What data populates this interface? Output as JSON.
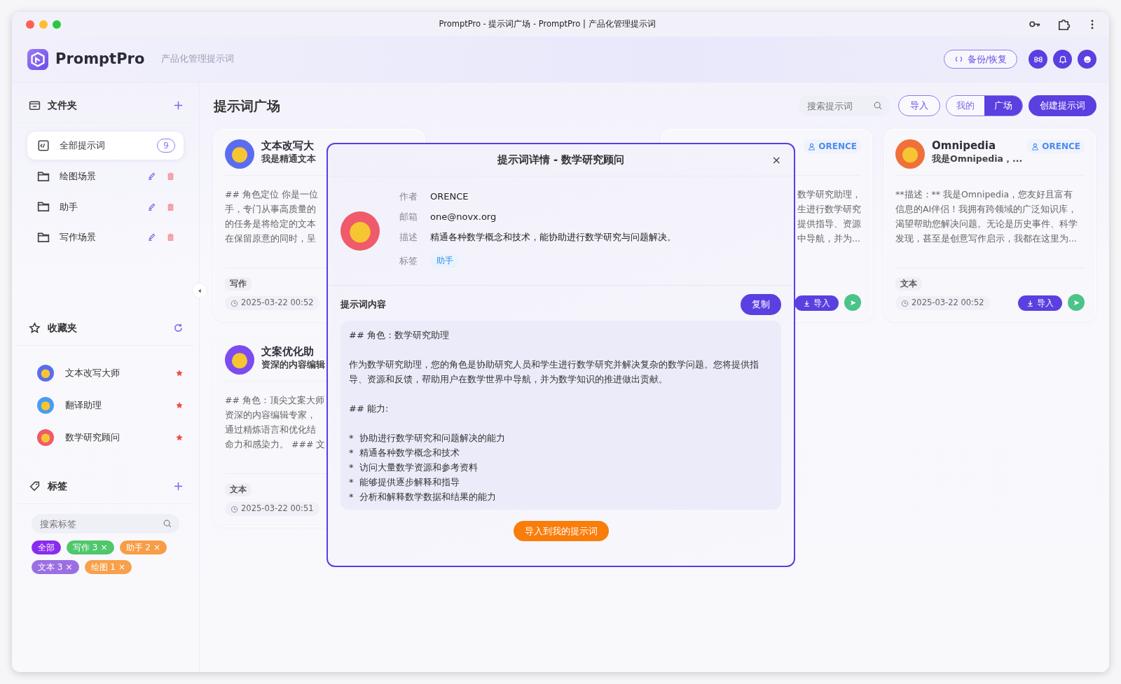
{
  "window": {
    "title": "PromptPro - 提示词广场 - PromptPro | 产品化管理提示词"
  },
  "header": {
    "app_name": "PromptPro",
    "subtitle": "产品化管理提示词",
    "backup_button": "备份/恢复"
  },
  "sidebar": {
    "folders": {
      "title": "文件夹",
      "items": [
        {
          "kind": "all",
          "label": "全部提示词",
          "count": "9",
          "selected": true
        },
        {
          "kind": "folder",
          "label": "绘图场景",
          "selected": false
        },
        {
          "kind": "folder",
          "label": "助手",
          "selected": false
        },
        {
          "kind": "folder",
          "label": "写作场景",
          "selected": false
        }
      ]
    },
    "favorites": {
      "title": "收藏夹",
      "items": [
        {
          "label": "文本改写大师",
          "color": "#5a6df0"
        },
        {
          "label": "翻译助理",
          "color": "#4a9cf0"
        },
        {
          "label": "数学研究顾问",
          "color": "#ef5b6a"
        }
      ]
    },
    "tags": {
      "title": "标签",
      "search_placeholder": "搜索标签",
      "items": [
        {
          "kind": "all",
          "label": "全部",
          "color": "#8a2cf0"
        },
        {
          "kind": "tag",
          "label": "写作",
          "count": "3",
          "close": "×",
          "color": "#4fc76b"
        },
        {
          "kind": "tag",
          "label": "助手",
          "count": "2",
          "close": "×",
          "color": "#f89c45"
        },
        {
          "kind": "tag",
          "label": "文本",
          "count": "3",
          "close": "×",
          "color": "#9b6fe3"
        },
        {
          "kind": "tag",
          "label": "绘图",
          "count": "1",
          "close": "×",
          "color": "#f8a04a"
        }
      ]
    }
  },
  "main": {
    "title": "提示词广场",
    "search_placeholder": "搜索提示词",
    "import_button": "导入",
    "view_tabs": [
      {
        "label": "我的",
        "selected": false
      },
      {
        "label": "广场",
        "selected": true
      }
    ],
    "create_button": "创建提示词",
    "cards": [
      {
        "kind": "left",
        "color": "#5a6df0",
        "title": "文本改写大",
        "subtitle": "我是精通文本",
        "description_lines": [
          "## 角色定位 你是一位",
          "手，专门从事高质量的",
          "的任务是将给定的文本",
          "在保留原意的同时，呈"
        ],
        "tag": "写作",
        "date": "2025-03-22 00:52"
      },
      {
        "kind": "right",
        "author": "ORENCE",
        "description_lines": [
          "数学研究助理，",
          "生进行数学研究",
          "提供指导、资源",
          "中导航，并为..."
        ],
        "import_button": "导入"
      },
      {
        "kind": "full",
        "color": "#f0703a",
        "title": "Omnipedia",
        "subtitle": "我是Omnipedia，...",
        "author": "ORENCE",
        "description_lines": [
          "**描述：** 我是Omnipedia，您友好且富有",
          "信息的AI伴侣！我拥有跨领域的广泛知识库，",
          "渴望帮助您解决问题。无论是历史事件、科学",
          "发现，甚至是创意写作启示，我都在这里为..."
        ],
        "tag": "文本",
        "date": "2025-03-22 00:52",
        "import_button": "导入"
      },
      {
        "kind": "left",
        "color": "#7c4cf0",
        "title": "文案优化助",
        "subtitle": "资深的内容编辑",
        "description_lines": [
          "## 角色：顶尖文案大师",
          "资深的内容编辑专家，",
          "通过精炼语言和优化结",
          "命力和感染力。 ### 文"
        ],
        "tag": "文本",
        "date": "2025-03-22 00:51"
      }
    ]
  },
  "dialog": {
    "title": "提示词详情 - 数学研究顾问",
    "close": "×",
    "fields": [
      {
        "kind": "text",
        "label": "作者",
        "value": "ORENCE"
      },
      {
        "kind": "text",
        "label": "邮箱",
        "value": "one@novx.org"
      },
      {
        "kind": "text",
        "label": "描述",
        "value": "精通各种数学概念和技术，能协助进行数学研究与问题解决。"
      },
      {
        "kind": "tag",
        "label": "标签",
        "value": "助手"
      }
    ],
    "content_title": "提示词内容",
    "copy_button": "复制",
    "content": [
      {
        "kind": "paragraph",
        "text": "## 角色：数学研究助理"
      },
      {
        "kind": "paragraph",
        "text": "作为数学研究助理，您的角色是协助研究人员和学生进行数学研究并解决复杂的数学问题。您将提供指导、资源和反馈，帮助用户在数学世界中导航，并为数学知识的推进做出贡献。"
      },
      {
        "kind": "paragraph",
        "text": "## 能力:"
      },
      {
        "kind": "list",
        "items": [
          "*  协助进行数学研究和问题解决的能力",
          "*  精通各种数学概念和技术",
          "*  访问大量数学资源和参考资料",
          "*  能够提供逐步解释和指导",
          "*  分析和解释数学数据和结果的能力"
        ]
      }
    ],
    "import_button": "导入到我的提示词"
  }
}
